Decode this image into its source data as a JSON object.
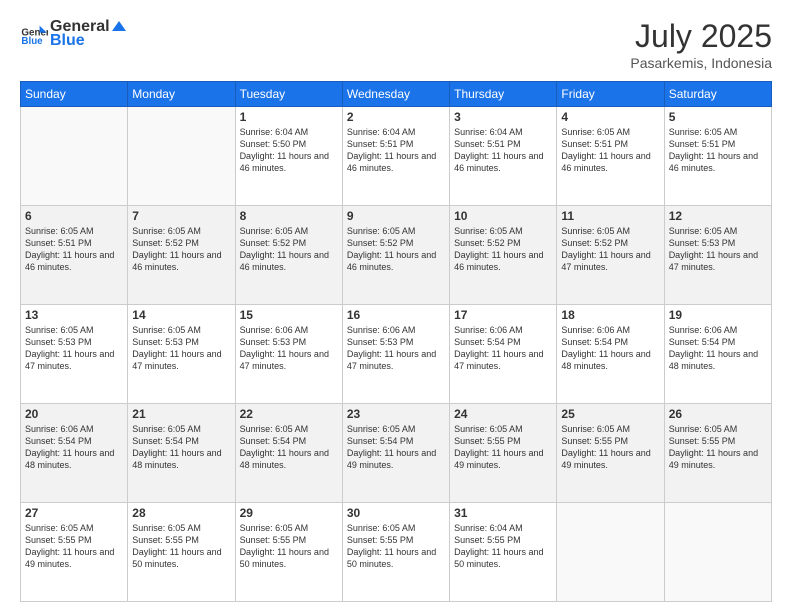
{
  "header": {
    "logo_general": "General",
    "logo_blue": "Blue",
    "month_year": "July 2025",
    "location": "Pasarkemis, Indonesia"
  },
  "weekdays": [
    "Sunday",
    "Monday",
    "Tuesday",
    "Wednesday",
    "Thursday",
    "Friday",
    "Saturday"
  ],
  "weeks": [
    [
      {
        "day": "",
        "info": ""
      },
      {
        "day": "",
        "info": ""
      },
      {
        "day": "1",
        "info": "Sunrise: 6:04 AM\nSunset: 5:50 PM\nDaylight: 11 hours and 46 minutes."
      },
      {
        "day": "2",
        "info": "Sunrise: 6:04 AM\nSunset: 5:51 PM\nDaylight: 11 hours and 46 minutes."
      },
      {
        "day": "3",
        "info": "Sunrise: 6:04 AM\nSunset: 5:51 PM\nDaylight: 11 hours and 46 minutes."
      },
      {
        "day": "4",
        "info": "Sunrise: 6:05 AM\nSunset: 5:51 PM\nDaylight: 11 hours and 46 minutes."
      },
      {
        "day": "5",
        "info": "Sunrise: 6:05 AM\nSunset: 5:51 PM\nDaylight: 11 hours and 46 minutes."
      }
    ],
    [
      {
        "day": "6",
        "info": "Sunrise: 6:05 AM\nSunset: 5:51 PM\nDaylight: 11 hours and 46 minutes."
      },
      {
        "day": "7",
        "info": "Sunrise: 6:05 AM\nSunset: 5:52 PM\nDaylight: 11 hours and 46 minutes."
      },
      {
        "day": "8",
        "info": "Sunrise: 6:05 AM\nSunset: 5:52 PM\nDaylight: 11 hours and 46 minutes."
      },
      {
        "day": "9",
        "info": "Sunrise: 6:05 AM\nSunset: 5:52 PM\nDaylight: 11 hours and 46 minutes."
      },
      {
        "day": "10",
        "info": "Sunrise: 6:05 AM\nSunset: 5:52 PM\nDaylight: 11 hours and 46 minutes."
      },
      {
        "day": "11",
        "info": "Sunrise: 6:05 AM\nSunset: 5:52 PM\nDaylight: 11 hours and 47 minutes."
      },
      {
        "day": "12",
        "info": "Sunrise: 6:05 AM\nSunset: 5:53 PM\nDaylight: 11 hours and 47 minutes."
      }
    ],
    [
      {
        "day": "13",
        "info": "Sunrise: 6:05 AM\nSunset: 5:53 PM\nDaylight: 11 hours and 47 minutes."
      },
      {
        "day": "14",
        "info": "Sunrise: 6:05 AM\nSunset: 5:53 PM\nDaylight: 11 hours and 47 minutes."
      },
      {
        "day": "15",
        "info": "Sunrise: 6:06 AM\nSunset: 5:53 PM\nDaylight: 11 hours and 47 minutes."
      },
      {
        "day": "16",
        "info": "Sunrise: 6:06 AM\nSunset: 5:53 PM\nDaylight: 11 hours and 47 minutes."
      },
      {
        "day": "17",
        "info": "Sunrise: 6:06 AM\nSunset: 5:54 PM\nDaylight: 11 hours and 47 minutes."
      },
      {
        "day": "18",
        "info": "Sunrise: 6:06 AM\nSunset: 5:54 PM\nDaylight: 11 hours and 48 minutes."
      },
      {
        "day": "19",
        "info": "Sunrise: 6:06 AM\nSunset: 5:54 PM\nDaylight: 11 hours and 48 minutes."
      }
    ],
    [
      {
        "day": "20",
        "info": "Sunrise: 6:06 AM\nSunset: 5:54 PM\nDaylight: 11 hours and 48 minutes."
      },
      {
        "day": "21",
        "info": "Sunrise: 6:05 AM\nSunset: 5:54 PM\nDaylight: 11 hours and 48 minutes."
      },
      {
        "day": "22",
        "info": "Sunrise: 6:05 AM\nSunset: 5:54 PM\nDaylight: 11 hours and 48 minutes."
      },
      {
        "day": "23",
        "info": "Sunrise: 6:05 AM\nSunset: 5:54 PM\nDaylight: 11 hours and 49 minutes."
      },
      {
        "day": "24",
        "info": "Sunrise: 6:05 AM\nSunset: 5:55 PM\nDaylight: 11 hours and 49 minutes."
      },
      {
        "day": "25",
        "info": "Sunrise: 6:05 AM\nSunset: 5:55 PM\nDaylight: 11 hours and 49 minutes."
      },
      {
        "day": "26",
        "info": "Sunrise: 6:05 AM\nSunset: 5:55 PM\nDaylight: 11 hours and 49 minutes."
      }
    ],
    [
      {
        "day": "27",
        "info": "Sunrise: 6:05 AM\nSunset: 5:55 PM\nDaylight: 11 hours and 49 minutes."
      },
      {
        "day": "28",
        "info": "Sunrise: 6:05 AM\nSunset: 5:55 PM\nDaylight: 11 hours and 50 minutes."
      },
      {
        "day": "29",
        "info": "Sunrise: 6:05 AM\nSunset: 5:55 PM\nDaylight: 11 hours and 50 minutes."
      },
      {
        "day": "30",
        "info": "Sunrise: 6:05 AM\nSunset: 5:55 PM\nDaylight: 11 hours and 50 minutes."
      },
      {
        "day": "31",
        "info": "Sunrise: 6:04 AM\nSunset: 5:55 PM\nDaylight: 11 hours and 50 minutes."
      },
      {
        "day": "",
        "info": ""
      },
      {
        "day": "",
        "info": ""
      }
    ]
  ]
}
